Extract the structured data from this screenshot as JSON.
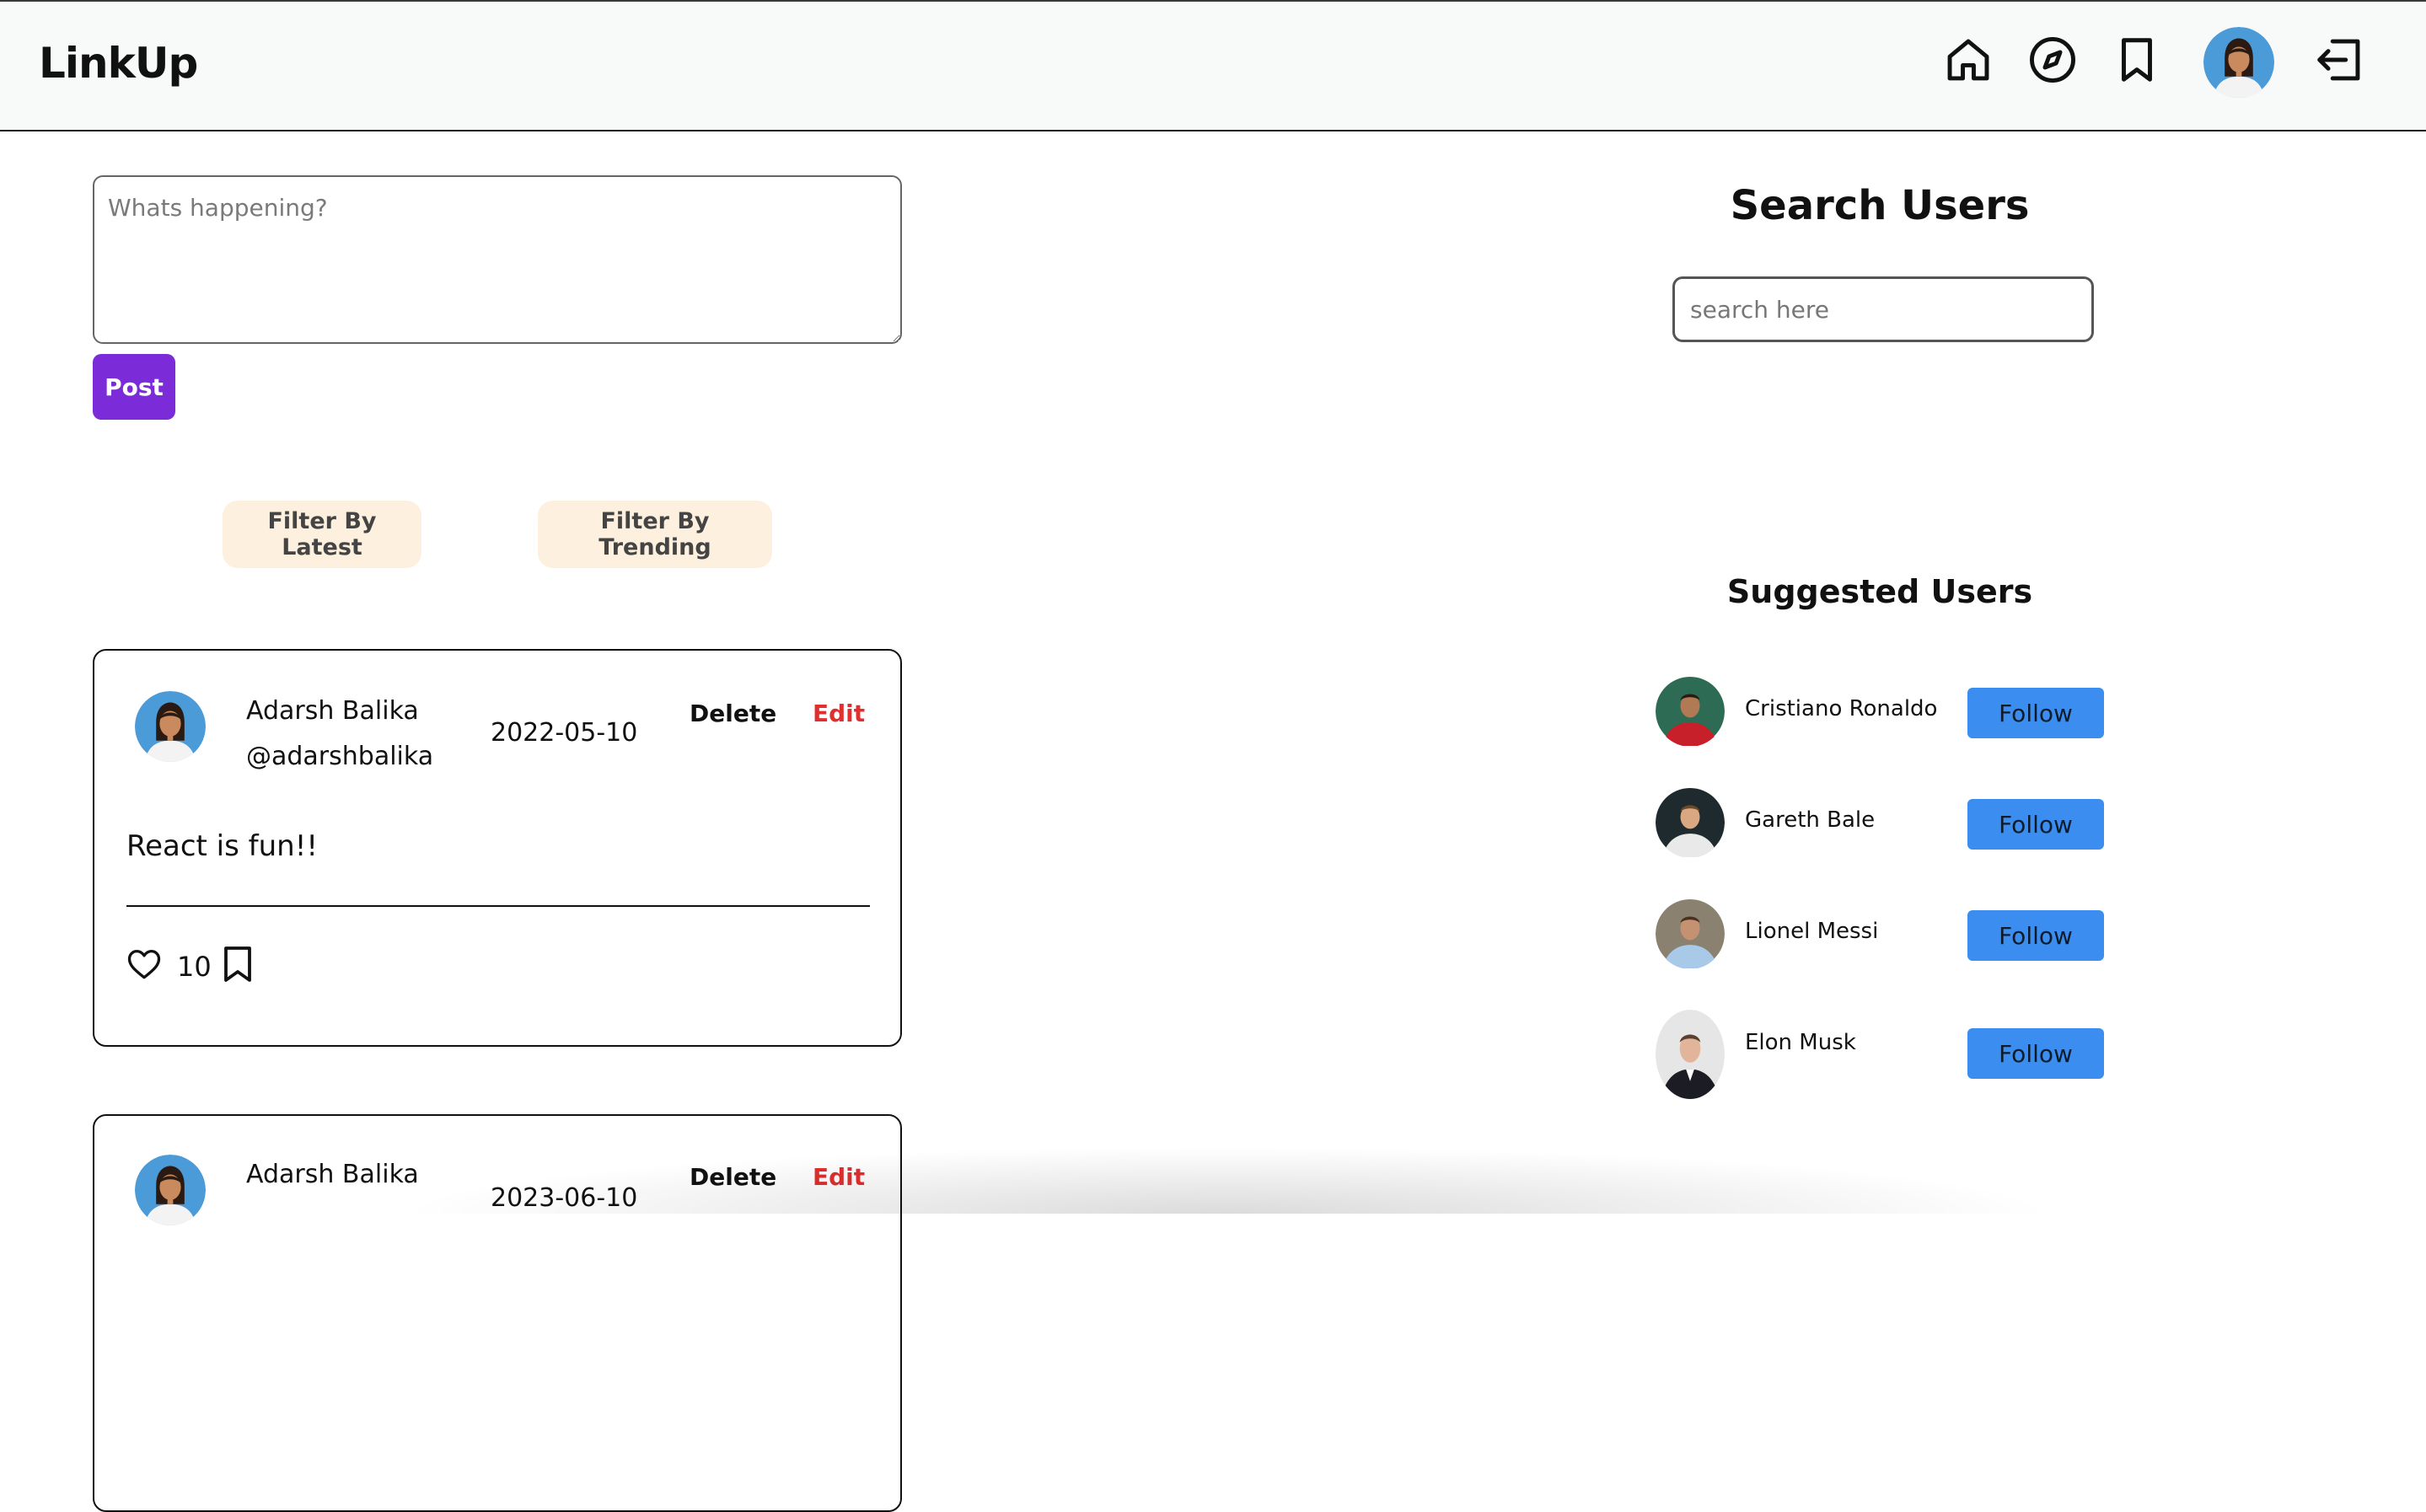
{
  "app": {
    "brand": "LinkUp"
  },
  "nav": {
    "icons": [
      "home-icon",
      "explore-icon",
      "bookmark-icon",
      "avatar",
      "logout-icon"
    ]
  },
  "composer": {
    "placeholder": "Whats happening?",
    "post_label": "Post"
  },
  "filters": {
    "latest": "Filter By Latest",
    "trending": "Filter By Trending"
  },
  "posts": [
    {
      "name": "Adarsh Balika",
      "handle": "@adarshbalika",
      "date": "2022-05-10",
      "delete_label": "Delete",
      "edit_label": "Edit",
      "content": "React is fun!!",
      "likes": "10"
    },
    {
      "name": "Adarsh Balika",
      "handle": "",
      "date": "2023-06-10",
      "delete_label": "Delete",
      "edit_label": "Edit",
      "content": "",
      "likes": ""
    }
  ],
  "search": {
    "title": "Search Users",
    "placeholder": "search here"
  },
  "suggested": {
    "title": "Suggested Users",
    "users": [
      {
        "name": "Cristiano Ronaldo",
        "follow_label": "Follow"
      },
      {
        "name": "Gareth Bale",
        "follow_label": "Follow"
      },
      {
        "name": "Lionel Messi",
        "follow_label": "Follow"
      },
      {
        "name": "Elon Musk",
        "follow_label": "Follow"
      }
    ]
  },
  "colors": {
    "accent_purple": "#7b2cd8",
    "follow_blue": "#3b8ef0",
    "edit_red": "#e12f2f",
    "filter_bg": "#fdf0de"
  }
}
